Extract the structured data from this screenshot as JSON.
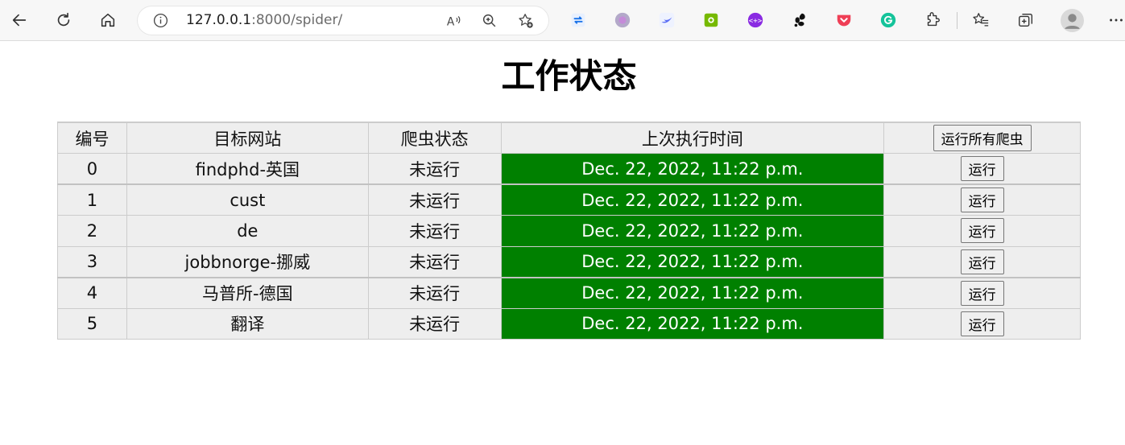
{
  "browser": {
    "url_host": "127.0.0.1",
    "url_rest": ":8000/spider/"
  },
  "page": {
    "title": "工作状态"
  },
  "table": {
    "headers": [
      "编号",
      "目标网站",
      "爬虫状态",
      "上次执行时间"
    ],
    "run_all_label": "运行所有爬虫",
    "run_label": "运行",
    "rows": [
      {
        "id": "0",
        "site": "findphd-英国",
        "status": "未运行",
        "last_run": "Dec. 22, 2022, 11:22 p.m."
      },
      {
        "id": "1",
        "site": "cust",
        "status": "未运行",
        "last_run": "Dec. 22, 2022, 11:22 p.m."
      },
      {
        "id": "2",
        "site": "de",
        "status": "未运行",
        "last_run": "Dec. 22, 2022, 11:22 p.m."
      },
      {
        "id": "3",
        "site": "jobbnorge-挪威",
        "status": "未运行",
        "last_run": "Dec. 22, 2022, 11:22 p.m."
      },
      {
        "id": "4",
        "site": "马普所-德国",
        "status": "未运行",
        "last_run": "Dec. 22, 2022, 11:22 p.m."
      },
      {
        "id": "5",
        "site": "翻译",
        "status": "未运行",
        "last_run": "Dec. 22, 2022, 11:22 p.m."
      }
    ]
  },
  "colors": {
    "time_cell_bg": "#008000",
    "table_bg": "#eeeeee"
  },
  "icons": {
    "nav": [
      "back-icon",
      "refresh-icon",
      "home-icon"
    ],
    "address": [
      "info-icon",
      "read-aloud-icon",
      "zoom-icon",
      "add-favorite-icon"
    ],
    "extensions": [
      "sync-extension-icon",
      "purple-circle-extension-icon",
      "swift-extension-icon",
      "green-extension-icon",
      "purple-face-extension-icon",
      "gnome-extension-icon",
      "pocket-extension-icon",
      "grammarly-extension-icon",
      "puzzle-extensions-icon"
    ],
    "right": [
      "favorites-icon",
      "collections-icon",
      "profile-avatar",
      "more-icon"
    ]
  }
}
